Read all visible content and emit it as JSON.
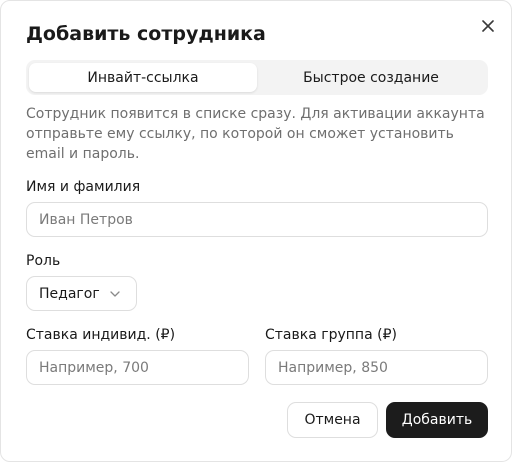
{
  "dialog": {
    "title": "Добавить сотрудника"
  },
  "tabs": [
    {
      "label": "Инвайт-ссылка",
      "active": true
    },
    {
      "label": "Быстрое создание",
      "active": false
    }
  ],
  "description": "Сотрудник появится в списке сразу. Для активации аккаунта отправьте ему ссылку, по которой он сможет установить email и пароль.",
  "form": {
    "name": {
      "label": "Имя и фамилия",
      "placeholder": "Иван Петров",
      "value": ""
    },
    "role": {
      "label": "Роль",
      "selected": "Педагог"
    },
    "rate_individual": {
      "label": "Ставка индивид. (₽)",
      "placeholder": "Например, 700",
      "value": ""
    },
    "rate_group": {
      "label": "Ставка группа (₽)",
      "placeholder": "Например, 850",
      "value": ""
    }
  },
  "actions": {
    "cancel_label": "Отмена",
    "submit_label": "Добавить"
  },
  "icons": {
    "close": "close-icon",
    "select": "chevron-down-icon"
  },
  "colors": {
    "primary_button": "#1c1c1c",
    "muted_text": "#6f6f6f",
    "border": "#dedede",
    "tab_track": "#f3f3f3"
  }
}
